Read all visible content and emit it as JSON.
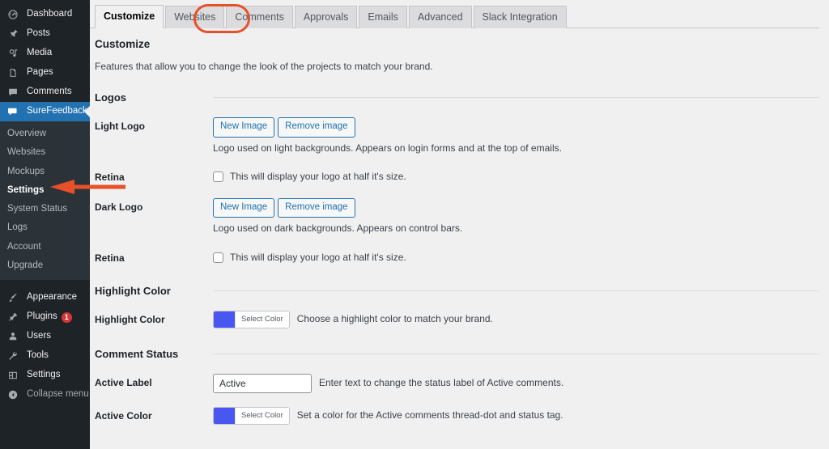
{
  "sidebar": {
    "top_items": [
      {
        "label": "Dashboard",
        "icon": "dashboard-icon",
        "badge": null,
        "dim": false
      },
      {
        "label": "Posts",
        "icon": "pin-icon",
        "badge": null,
        "dim": false
      },
      {
        "label": "Media",
        "icon": "media-icon",
        "badge": null,
        "dim": false
      },
      {
        "label": "Pages",
        "icon": "page-icon",
        "badge": null,
        "dim": false
      },
      {
        "label": "Comments",
        "icon": "comment-icon",
        "badge": null,
        "dim": false
      }
    ],
    "current_item": {
      "label": "SureFeedback",
      "icon": "feedback-icon"
    },
    "submenu": [
      {
        "label": "Overview",
        "active": false
      },
      {
        "label": "Websites",
        "active": false
      },
      {
        "label": "Mockups",
        "active": false
      },
      {
        "label": "Settings",
        "active": true
      },
      {
        "label": "System Status",
        "active": false
      },
      {
        "label": "Logs",
        "active": false
      },
      {
        "label": "Account",
        "active": false
      },
      {
        "label": "Upgrade",
        "active": false
      }
    ],
    "bottom_items": [
      {
        "label": "Appearance",
        "icon": "brush-icon",
        "badge": null,
        "dim": false
      },
      {
        "label": "Plugins",
        "icon": "plugin-icon",
        "badge": "1",
        "dim": false
      },
      {
        "label": "Users",
        "icon": "user-icon",
        "badge": null,
        "dim": false
      },
      {
        "label": "Tools",
        "icon": "wrench-icon",
        "badge": null,
        "dim": false
      },
      {
        "label": "Settings",
        "icon": "settings-icon",
        "badge": null,
        "dim": false
      },
      {
        "label": "Collapse menu",
        "icon": "collapse-icon",
        "badge": null,
        "dim": true
      }
    ]
  },
  "tabs": [
    {
      "label": "Customize",
      "active": true
    },
    {
      "label": "Websites",
      "active": false
    },
    {
      "label": "Comments",
      "active": false
    },
    {
      "label": "Approvals",
      "active": false
    },
    {
      "label": "Emails",
      "active": false
    },
    {
      "label": "Advanced",
      "active": false
    },
    {
      "label": "Slack Integration",
      "active": false
    }
  ],
  "page": {
    "title": "Customize",
    "description": "Features that allow you to change the look of the projects to match your brand."
  },
  "sections": {
    "logos": {
      "title": "Logos"
    },
    "highlight": {
      "title": "Highlight Color"
    },
    "comment_status": {
      "title": "Comment Status"
    }
  },
  "rows": {
    "light_logo": {
      "label": "Light Logo",
      "new_image": "New Image",
      "remove_image": "Remove image",
      "help": "Logo used on light backgrounds. Appears on login forms and at the top of emails."
    },
    "retina_light": {
      "label": "Retina",
      "checkbox_label": "This will display your logo at half it's size.",
      "checked": false
    },
    "dark_logo": {
      "label": "Dark Logo",
      "new_image": "New Image",
      "remove_image": "Remove image",
      "help": "Logo used on dark backgrounds. Appears on control bars."
    },
    "retina_dark": {
      "label": "Retina",
      "checkbox_label": "This will display your logo at half it's size.",
      "checked": false
    },
    "highlight_color": {
      "label": "Highlight Color",
      "select_color": "Select Color",
      "color": "#4a56f0",
      "help": "Choose a highlight color to match your brand."
    },
    "active_label": {
      "label": "Active Label",
      "value": "Active",
      "help": "Enter text to change the status label of Active comments."
    },
    "active_color": {
      "label": "Active Color",
      "select_color": "Select Color",
      "color": "#4a56f0",
      "help": "Set a color for the Active comments thread-dot and status tag."
    }
  },
  "annotations": {
    "tab_highlight_color": "#e8502a",
    "arrow_color": "#e8502a",
    "arrow_target": "Settings"
  }
}
